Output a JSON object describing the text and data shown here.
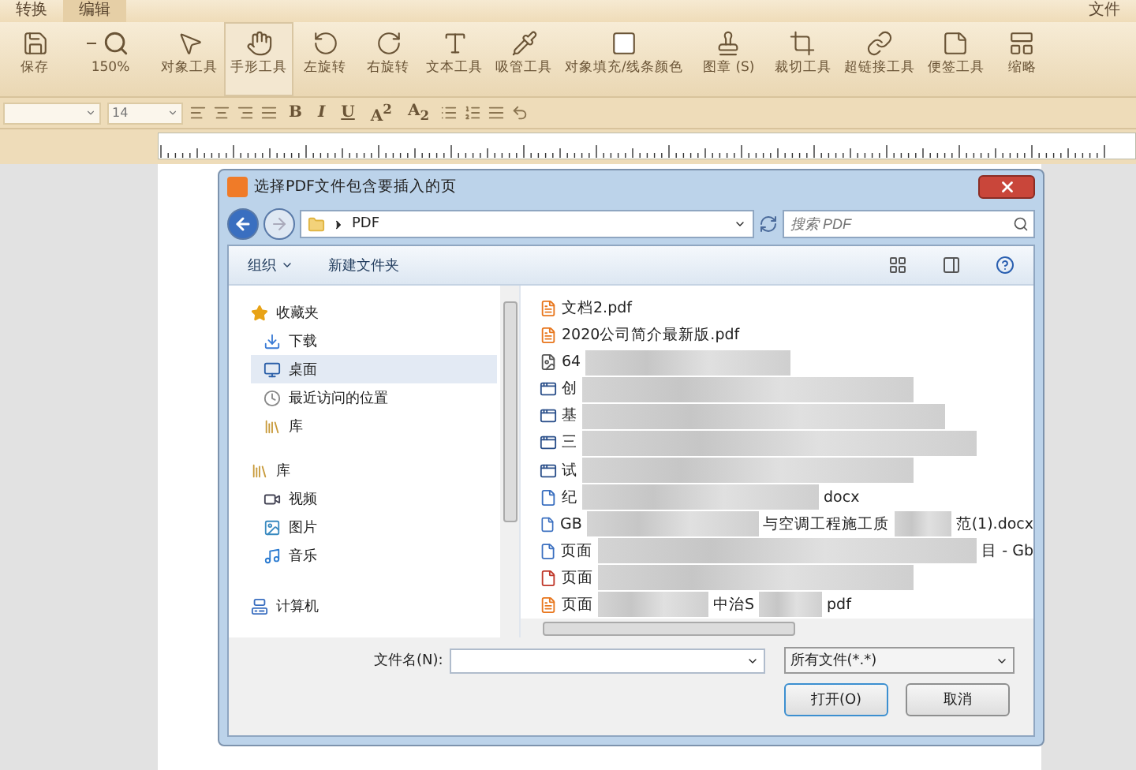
{
  "menu": {
    "tabs": [
      {
        "label": "转换",
        "selected": false
      },
      {
        "label": "编辑",
        "selected": true
      }
    ],
    "right": [
      "文件"
    ]
  },
  "toolbar": {
    "items": [
      {
        "kind": "save",
        "label": "保存",
        "selected": false
      },
      {
        "kind": "zoom",
        "label": "150%",
        "selected": false
      },
      {
        "kind": "pointer",
        "label": "对象工具",
        "selected": false
      },
      {
        "kind": "hand",
        "label": "手形工具",
        "selected": true
      },
      {
        "kind": "rotl",
        "label": "左旋转",
        "selected": false
      },
      {
        "kind": "rotr",
        "label": "右旋转",
        "selected": false
      },
      {
        "kind": "text",
        "label": "文本工具",
        "selected": false
      },
      {
        "kind": "pipette",
        "label": "吸管工具",
        "selected": false
      },
      {
        "kind": "fill",
        "label": "对象填充/线条颜色",
        "selected": false
      },
      {
        "kind": "stamp",
        "label": "图章 (S)",
        "selected": false
      },
      {
        "kind": "crop",
        "label": "裁切工具",
        "selected": false
      },
      {
        "kind": "link",
        "label": "超链接工具",
        "selected": false
      },
      {
        "kind": "note",
        "label": "便签工具",
        "selected": false
      },
      {
        "kind": "thumb",
        "label": "缩略",
        "selected": false
      }
    ]
  },
  "format": {
    "font_size": "14",
    "styles": [
      "B",
      "I",
      "U",
      "A$^{2}$",
      "A$_{2}$"
    ]
  },
  "dialog": {
    "title": "选择PDF文件包含要插入的页",
    "path": "PDF",
    "search": {
      "placeholder": "搜索 PDF"
    },
    "commands": [
      {
        "label": "组织",
        "dropdown": true
      },
      {
        "label": "新建文件夹",
        "dropdown": false
      }
    ],
    "nav": [
      {
        "kind": "star",
        "label": "收藏夹",
        "selected": false,
        "children": [
          {
            "kind": "download",
            "label": "下载",
            "selected": false
          },
          {
            "kind": "desktop",
            "label": "桌面",
            "selected": true
          },
          {
            "kind": "recent",
            "label": "最近访问的位置",
            "selected": false
          },
          {
            "kind": "library",
            "label": "库",
            "selected": false
          }
        ]
      },
      {
        "kind": "library",
        "label": "库",
        "selected": false,
        "children": [
          {
            "kind": "video",
            "label": "视频",
            "selected": false
          },
          {
            "kind": "picture",
            "label": "图片",
            "selected": false
          },
          {
            "kind": "music",
            "label": "音乐",
            "selected": false
          }
        ]
      },
      {
        "kind": "computer",
        "label": "计算机",
        "selected": false
      }
    ],
    "files": [
      {
        "kind": "pdf",
        "name": "文档2.pdf",
        "redacted": false
      },
      {
        "kind": "pdf",
        "name": "2020公司简介最新版.pdf",
        "redacted": false
      },
      {
        "kind": "image",
        "name": "64",
        "redacted": true
      },
      {
        "kind": "app",
        "name": "创",
        "redacted": true
      },
      {
        "kind": "app",
        "name": "基",
        "redacted": true
      },
      {
        "kind": "app",
        "name": "三",
        "redacted": true
      },
      {
        "kind": "app",
        "name": "试",
        "redacted": true
      },
      {
        "kind": "doc",
        "name": "纪",
        "redacted": true,
        "tails": [
          "docx"
        ]
      },
      {
        "kind": "doc",
        "name": "GB",
        "redacted": true,
        "tails": [
          "与空调工程施工质",
          "范(1).docx"
        ]
      },
      {
        "kind": "doc",
        "name": "页面",
        "redacted": true,
        "tails": [
          "目 - Gb"
        ]
      },
      {
        "kind": "wps",
        "name": "页面",
        "redacted": true
      },
      {
        "kind": "pdf",
        "name": "页面",
        "redacted": true,
        "tails": [
          "中治S",
          "pdf"
        ]
      }
    ],
    "filename": {
      "label": "文件名(N):"
    },
    "filter": "所有文件(*.*)",
    "buttons": [
      {
        "kind": "primary",
        "label": "打开(O)"
      },
      {
        "kind": "normal",
        "label": "取消"
      }
    ]
  }
}
